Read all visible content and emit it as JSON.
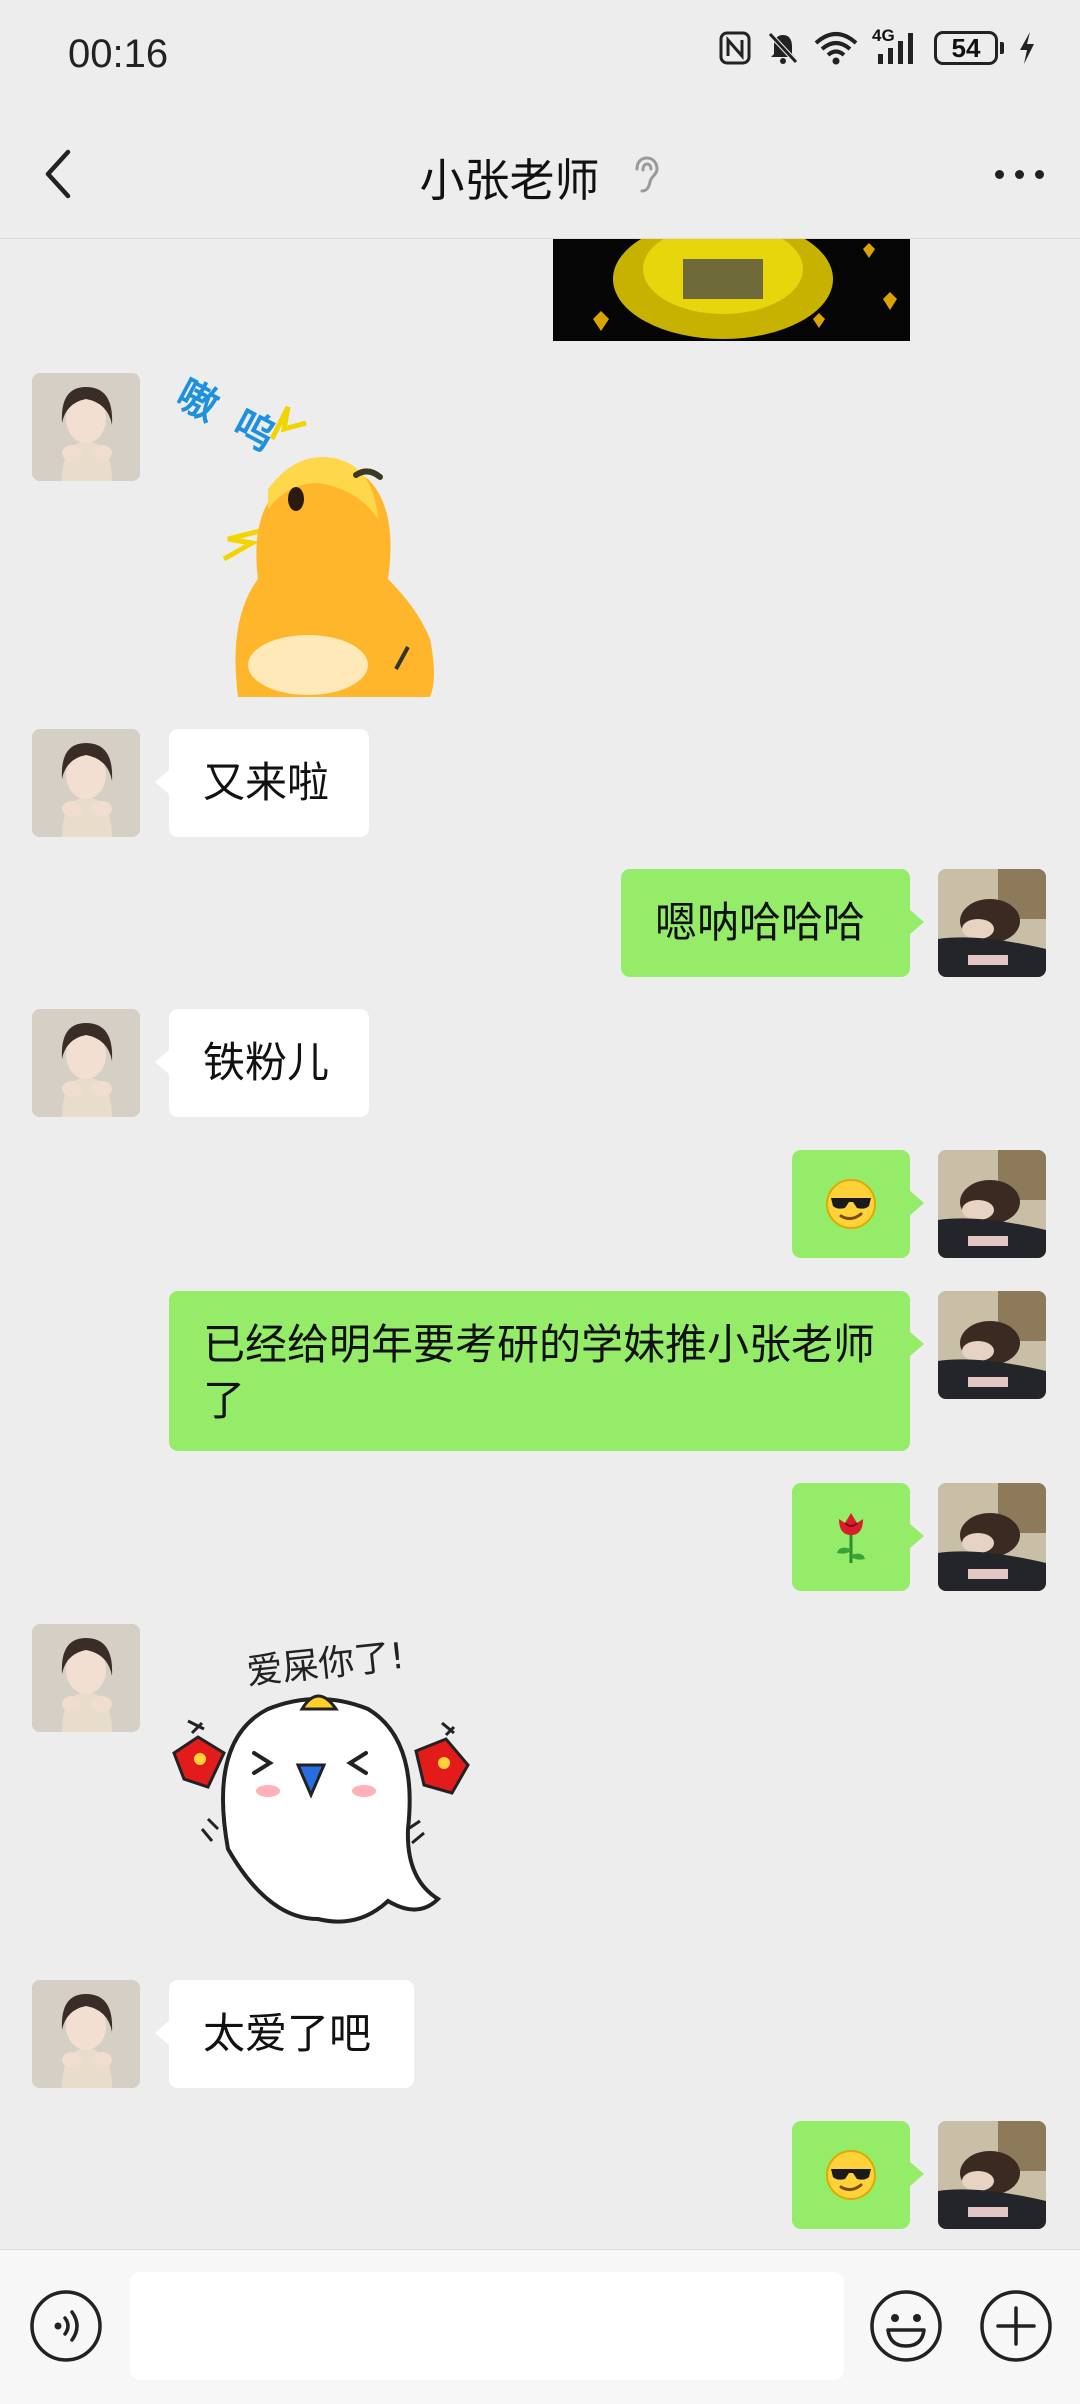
{
  "status_bar": {
    "time": "00:16",
    "network": "4G",
    "battery": "54"
  },
  "header": {
    "title": "小张老师"
  },
  "messages": [
    {
      "side": "left",
      "type": "text",
      "text": "又来啦"
    },
    {
      "side": "right",
      "type": "text",
      "text": "嗯呐哈哈哈"
    },
    {
      "side": "left",
      "type": "text",
      "text": "铁粉儿"
    },
    {
      "side": "right",
      "type": "emoji",
      "text": "😎"
    },
    {
      "side": "right",
      "type": "text",
      "text": "已经给明年要考研的学妹推小张老师了"
    },
    {
      "side": "right",
      "type": "emoji",
      "text": "🌹"
    },
    {
      "side": "left",
      "type": "text",
      "text": "太爱了吧"
    },
    {
      "side": "right",
      "type": "emoji",
      "text": "😎"
    }
  ],
  "stickers": {
    "chick_caption": "嗷呜",
    "ghost_caption": "爱屎你了!"
  },
  "colors": {
    "bg": "#ededed",
    "bubble_self": "#95ec69",
    "bubble_other": "#ffffff"
  }
}
